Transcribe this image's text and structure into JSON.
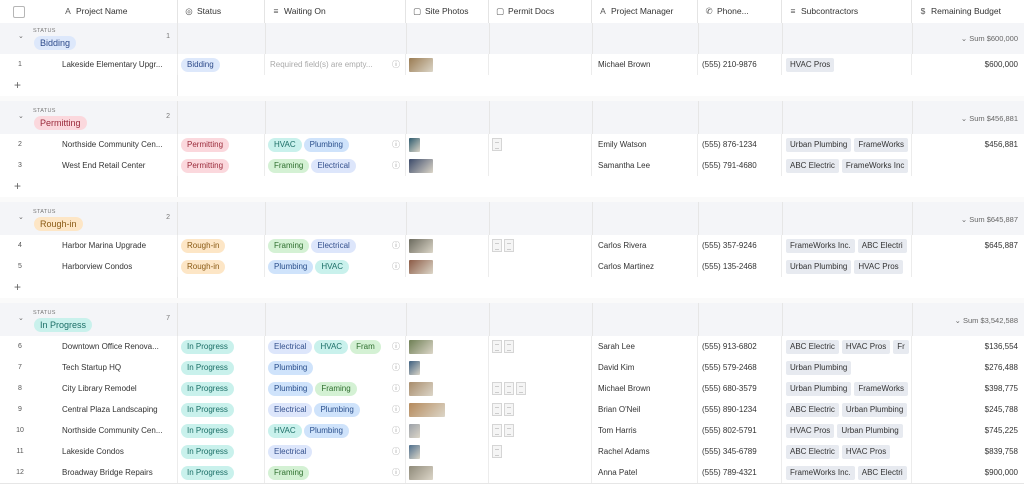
{
  "columns": [
    {
      "icon": "A",
      "label": "Project Name"
    },
    {
      "icon": "◎",
      "label": "Status"
    },
    {
      "icon": "≡",
      "label": "Waiting On"
    },
    {
      "icon": "▢",
      "label": "Site Photos"
    },
    {
      "icon": "▢",
      "label": "Permit Docs"
    },
    {
      "icon": "A",
      "label": "Project Manager"
    },
    {
      "icon": "✆",
      "label": "Phone..."
    },
    {
      "icon": "≡",
      "label": "Subcontractors"
    },
    {
      "icon": "$",
      "label": "Remaining Budget"
    }
  ],
  "colors": {
    "Bidding": {
      "bg": "#dde8fb",
      "fg": "#2d4a8a"
    },
    "Permitting": {
      "bg": "#fbd8dd",
      "fg": "#9a2a3a"
    },
    "Rough-in": {
      "bg": "#fde6c6",
      "fg": "#8a5a14"
    },
    "In Progress": {
      "bg": "#c9f1ec",
      "fg": "#1b6e66"
    },
    "HVAC": {
      "bg": "#c9f1ec",
      "fg": "#1b6e66"
    },
    "Plumbing": {
      "bg": "#cfe3fb",
      "fg": "#2a4f8c"
    },
    "Framing": {
      "bg": "#d4f1d4",
      "fg": "#2f6f2f"
    },
    "Electrical": {
      "bg": "#dde6fb",
      "fg": "#34508d"
    }
  },
  "groups": [
    {
      "field_label": "STATUS",
      "status": "Bidding",
      "count": "1",
      "sum": "Sum $600,000",
      "rows": [
        {
          "num": "1",
          "name": "Lakeside Elementary Upgr...",
          "status": "Bidding",
          "waiting": [],
          "waiting_placeholder": "Required field(s) are empty...",
          "photos": [
            {
              "kind": "wide",
              "color": "#9a7b52"
            }
          ],
          "docs": 0,
          "pm": "Michael Brown",
          "phone": "(555) 210-9876",
          "subs": [
            "HVAC Pros"
          ],
          "budget": "$600,000"
        }
      ]
    },
    {
      "field_label": "STATUS",
      "status": "Permitting",
      "count": "2",
      "sum": "Sum $456,881",
      "rows": [
        {
          "num": "2",
          "name": "Northside Community Cen...",
          "status": "Permitting",
          "waiting": [
            "HVAC",
            "Plumbing"
          ],
          "photos": [
            {
              "kind": "sq",
              "color": "#2d5a6e"
            }
          ],
          "docs": 1,
          "pm": "Emily Watson",
          "phone": "(555) 876-1234",
          "subs": [
            "Urban Plumbing",
            "FrameWorks"
          ],
          "budget": "$456,881"
        },
        {
          "num": "3",
          "name": "West End Retail Center",
          "status": "Permitting",
          "waiting": [
            "Framing",
            "Electrical"
          ],
          "photos": [
            {
              "kind": "wide",
              "color": "#3b4a6a"
            }
          ],
          "docs": 0,
          "pm": "Samantha Lee",
          "phone": "(555) 791-4680",
          "subs": [
            "ABC Electric",
            "FrameWorks Inc"
          ],
          "budget": ""
        }
      ]
    },
    {
      "field_label": "STATUS",
      "status": "Rough-in",
      "count": "2",
      "sum": "Sum $645,887",
      "rows": [
        {
          "num": "4",
          "name": "Harbor Marina Upgrade",
          "status": "Rough-in",
          "waiting": [
            "Framing",
            "Electrical"
          ],
          "photos": [
            {
              "kind": "wide",
              "color": "#6b6a5e"
            }
          ],
          "docs": 2,
          "pm": "Carlos Rivera",
          "phone": "(555) 357-9246",
          "subs": [
            "FrameWorks Inc.",
            "ABC Electri"
          ],
          "budget": "$645,887"
        },
        {
          "num": "5",
          "name": "Harborview Condos",
          "status": "Rough-in",
          "waiting": [
            "Plumbing",
            "HVAC"
          ],
          "photos": [
            {
              "kind": "wide",
              "color": "#8b5a45"
            }
          ],
          "docs": 0,
          "pm": "Carlos Martinez",
          "phone": "(555) 135-2468",
          "subs": [
            "Urban Plumbing",
            "HVAC Pros"
          ],
          "budget": ""
        }
      ]
    },
    {
      "field_label": "STATUS",
      "status": "In Progress",
      "count": "7",
      "sum": "Sum $3,542,588",
      "rows": [
        {
          "num": "6",
          "name": "Downtown Office Renova...",
          "status": "In Progress",
          "waiting": [
            "Electrical",
            "HVAC",
            "Fram"
          ],
          "photos": [
            {
              "kind": "wide",
              "color": "#6e7f55"
            }
          ],
          "docs": 2,
          "pm": "Sarah Lee",
          "phone": "(555) 913-6802",
          "subs": [
            "ABC Electric",
            "HVAC Pros",
            "Fr"
          ],
          "budget": "$136,554"
        },
        {
          "num": "7",
          "name": "Tech Startup HQ",
          "status": "In Progress",
          "waiting": [
            "Plumbing"
          ],
          "photos": [
            {
              "kind": "sq",
              "color": "#3d5f80"
            }
          ],
          "docs": 0,
          "pm": "David Kim",
          "phone": "(555) 579-2468",
          "subs": [
            "Urban Plumbing"
          ],
          "budget": "$276,488"
        },
        {
          "num": "8",
          "name": "City Library Remodel",
          "status": "In Progress",
          "waiting": [
            "Plumbing",
            "Framing"
          ],
          "photos": [
            {
              "kind": "wide",
              "color": "#a88c6c"
            }
          ],
          "docs": 3,
          "pm": "Michael Brown",
          "phone": "(555) 680-3579",
          "subs": [
            "Urban Plumbing",
            "FrameWorks"
          ],
          "budget": "$398,775"
        },
        {
          "num": "9",
          "name": "Central Plaza Landscaping",
          "status": "In Progress",
          "waiting": [
            "Electrical",
            "Plumbing"
          ],
          "photos": [
            {
              "kind": "wider",
              "color": "#b58a5c"
            }
          ],
          "docs": 2,
          "pm": "Brian O'Neil",
          "phone": "(555) 890-1234",
          "subs": [
            "ABC Electric",
            "Urban Plumbing"
          ],
          "budget": "$245,788"
        },
        {
          "num": "10",
          "name": "Northside Community Cen...",
          "status": "In Progress",
          "waiting": [
            "HVAC",
            "Plumbing"
          ],
          "photos": [
            {
              "kind": "sq",
              "color": "#9aa0a8"
            }
          ],
          "docs": 2,
          "pm": "Tom Harris",
          "phone": "(555) 802-5791",
          "subs": [
            "HVAC Pros",
            "Urban Plumbing"
          ],
          "budget": "$745,225"
        },
        {
          "num": "11",
          "name": "Lakeside Condos",
          "status": "In Progress",
          "waiting": [
            "Electrical"
          ],
          "photos": [
            {
              "kind": "sq",
              "color": "#4e6f8d"
            }
          ],
          "docs": 1,
          "pm": "Rachel Adams",
          "phone": "(555) 345-6789",
          "subs": [
            "ABC Electric",
            "HVAC Pros"
          ],
          "budget": "$839,758"
        },
        {
          "num": "12",
          "name": "Broadway Bridge Repairs",
          "status": "In Progress",
          "waiting": [
            "Framing"
          ],
          "photos": [
            {
              "kind": "wide",
              "color": "#8f8a7a"
            }
          ],
          "docs": 0,
          "pm": "Anna Patel",
          "phone": "(555) 789-4321",
          "subs": [
            "FrameWorks Inc.",
            "ABC Electri"
          ],
          "budget": "$900,000"
        }
      ]
    }
  ]
}
